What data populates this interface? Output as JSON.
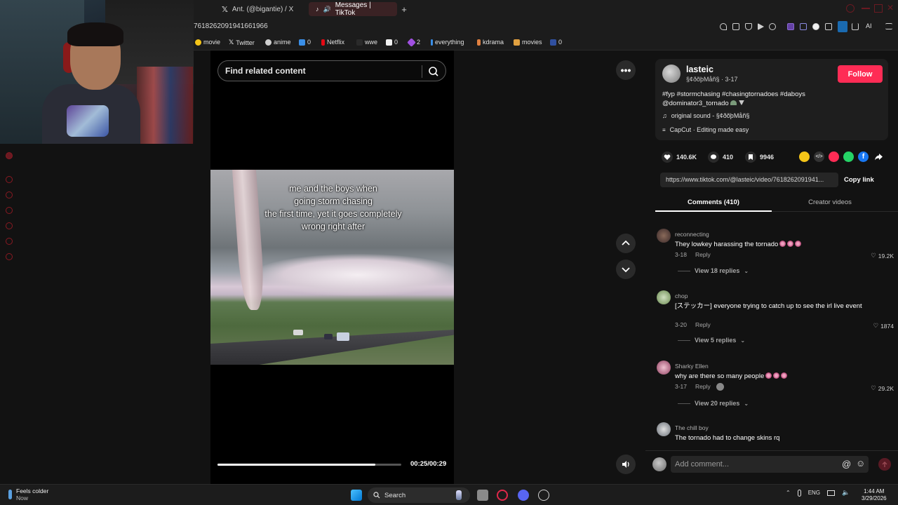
{
  "browser": {
    "tabs": [
      {
        "label": "Ant. (@bigantie) / X",
        "active": false
      },
      {
        "label": "Messages | TikTok",
        "active": true
      }
    ],
    "url_fragment": "7618262091941661966",
    "bookmarks": [
      {
        "label": "movie",
        "icon": "play-icon",
        "color": "#f5c518"
      },
      {
        "label": "Twitter",
        "icon": "x-logo-icon",
        "color": "#ffffff"
      },
      {
        "label": "anime",
        "icon": "anime-icon",
        "color": "#cfcfcf"
      },
      {
        "label": "0",
        "icon": "app-icon",
        "color": "#3a8ee6"
      },
      {
        "label": "Netflix",
        "icon": "netflix-icon",
        "color": "#e50914"
      },
      {
        "label": "wwe",
        "icon": "wwe-icon",
        "color": "#2a2a2a"
      },
      {
        "label": "0",
        "icon": "doc-icon",
        "color": "#f0f0f0"
      },
      {
        "label": "2",
        "icon": "gem-icon",
        "color": "#a050e0"
      },
      {
        "label": "everything",
        "icon": "bookmark-icon",
        "color": "#3a8ee6"
      },
      {
        "label": "kdrama",
        "icon": "kdrama-icon",
        "color": "#e08040"
      },
      {
        "label": "movies",
        "icon": "popcorn-icon",
        "color": "#e0a040"
      },
      {
        "label": "0",
        "icon": "flag-icon",
        "color": "#3050a0"
      }
    ],
    "toolbar_ai": "AI"
  },
  "search": {
    "placeholder": "Find related content"
  },
  "video": {
    "caption": "me and the boys when\ngoing storm chasing\nthe first time, yet it goes completely\nwrong right after",
    "time": "00:25/00:29",
    "progress_fraction": 0.86
  },
  "post": {
    "username": "lasteic",
    "nickname": "§¢ðõþMåñ§ · 3-17",
    "description": "#fyp #stormchasing #chasingtornadoes #daboys @dominator3_tornado",
    "sound": "original sound - §¢ðõþMåñ§",
    "capcut": "CapCut · Editing made easy",
    "follow_label": "Follow",
    "likes": "140.6K",
    "comments": "410",
    "saves": "9946",
    "link": "https://www.tiktok.com/@lasteic/video/7618262091941...",
    "copy_label": "Copy link",
    "share_colors": [
      "#f5c518",
      "#333333",
      "#fe2c55",
      "#25d366",
      "#1877f2"
    ]
  },
  "panel_tabs": {
    "comments": "Comments (410)",
    "creator": "Creator videos"
  },
  "comments": [
    {
      "name": "reconnecting",
      "text": "They lowkey harassing the tornado",
      "date": "3-18",
      "reply": "Reply",
      "likes": "19.2K",
      "replies": "View 18 replies",
      "avatar": "#6a4a3a"
    },
    {
      "name": "chop",
      "text": "[ステッカー] everyone trying to catch up to see the irl live event",
      "date": "3-20",
      "reply": "Reply",
      "likes": "1874",
      "replies": "View 5 replies",
      "avatar": "#8ab070"
    },
    {
      "name": "Sharky Ellen",
      "text": "why are there so many people",
      "date": "3-17",
      "reply": "Reply",
      "likes": "29.2K",
      "replies": "View 20 replies",
      "avatar": "#c06080"
    },
    {
      "name": "The chill boy",
      "text": "The tornado had to change skins rq",
      "date": "",
      "reply": "",
      "likes": "",
      "replies": "",
      "avatar": "#9aa0a6"
    }
  ],
  "comment_box": {
    "placeholder": "Add comment..."
  },
  "taskbar": {
    "weather_title": "Feels colder",
    "weather_sub": "Now",
    "search": "Search",
    "lang": "ENG",
    "time": "1:44 AM",
    "date": "3/29/2026"
  },
  "colors": {
    "accent": "#fe2c55",
    "background": "#121212"
  }
}
